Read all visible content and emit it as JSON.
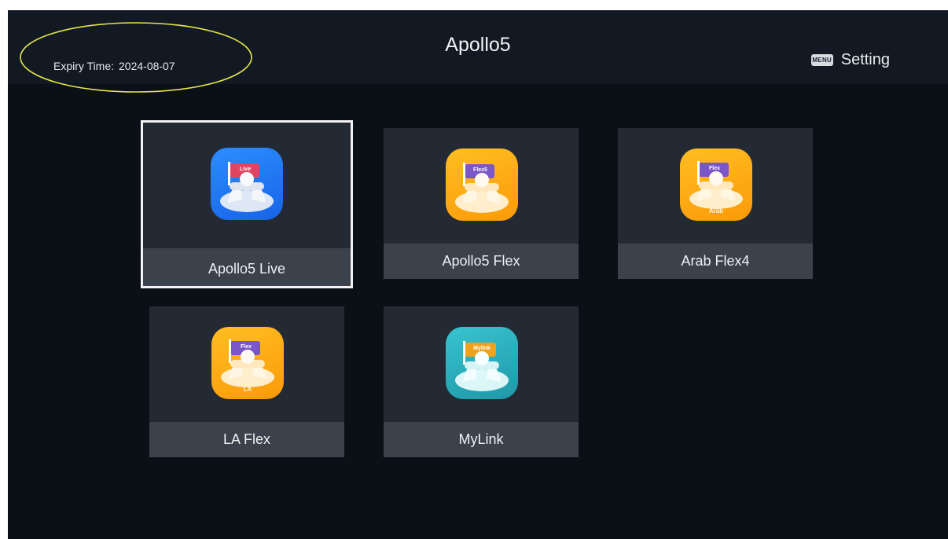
{
  "header": {
    "expiry_label": "Expiry Time:",
    "expiry_value": "2024-08-07",
    "title": "Apollo5",
    "menu_key": "MENU",
    "setting_label": "Setting"
  },
  "apps": [
    {
      "label": "Apollo5 Live",
      "icon": "apollo5-live-icon",
      "flag": "Live",
      "sub": "",
      "selected": true
    },
    {
      "label": "Apollo5 Flex",
      "icon": "apollo5-flex-icon",
      "flag": "Flex5",
      "sub": "",
      "selected": false
    },
    {
      "label": "Arab Flex4",
      "icon": "arab-flex4-icon",
      "flag": "Flex",
      "sub": "Arab",
      "selected": false
    },
    {
      "label": "LA Flex",
      "icon": "la-flex-icon",
      "flag": "Flex",
      "sub": "LA",
      "selected": false
    },
    {
      "label": "MyLink",
      "icon": "mylink-icon",
      "flag": "Mylink",
      "sub": "",
      "selected": false
    }
  ],
  "colors": {
    "background": "#0b1017",
    "tile": "#242a33",
    "tile_label": "#3b424c",
    "highlight_ellipse": "#e6e64a",
    "selection_border": "#f3f3f3",
    "live_icon": "#1f78f4",
    "flex_icon": "#fdab12",
    "mylink_icon": "#2cb2bf"
  }
}
